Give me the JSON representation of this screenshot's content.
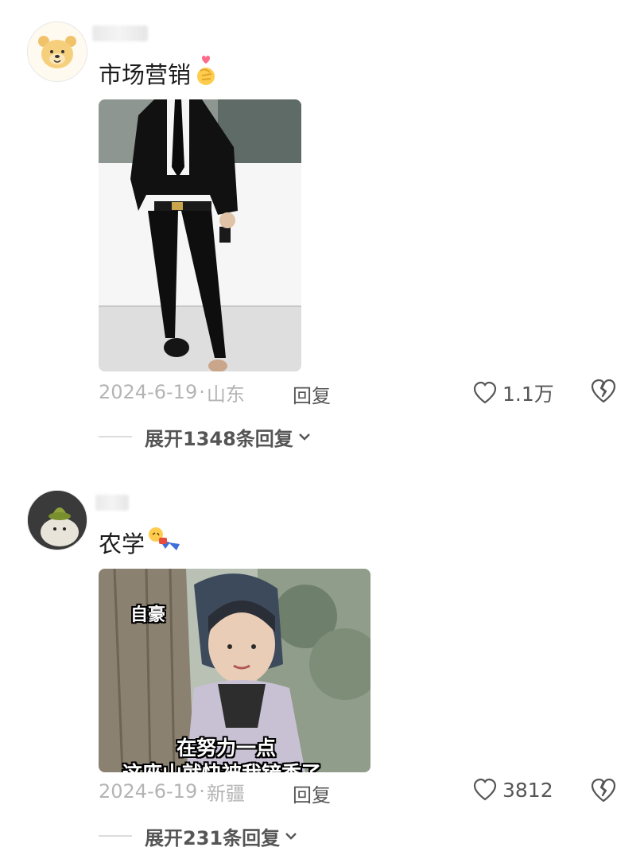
{
  "comments": [
    {
      "text": "市场营销",
      "emoji": "finger-heart-emoji",
      "date": "2024-6-19",
      "location": "山东",
      "reply_label": "回复",
      "likes": "1.1万",
      "expand_label": "展开1348条回复"
    },
    {
      "text": "农学",
      "emoji": "falling-emoji",
      "date": "2024-6-19",
      "location": "新疆",
      "reply_label": "回复",
      "likes": "3812",
      "expand_label": "展开231条回复",
      "image_captions": [
        "自豪",
        "在努力一点",
        "这座山就快被我铲秃了"
      ]
    }
  ],
  "colors": {
    "meta_text": "#b4b4b4",
    "action_text": "#555555"
  }
}
